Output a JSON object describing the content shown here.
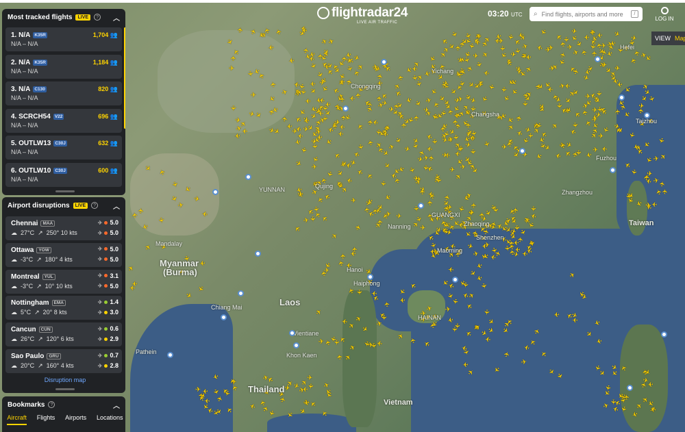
{
  "header": {
    "logo_text": "flightradar24",
    "logo_tagline": "LIVE AIR TRAFFIC",
    "time": "03:20",
    "time_zone": "UTC",
    "search_placeholder": "Find flights, airports and more",
    "search_shortcut": "/",
    "login_label": "LOG IN",
    "view_label": "VIEW",
    "view_value": "Map"
  },
  "tracked": {
    "title": "Most tracked flights",
    "live_badge": "LIVE",
    "flights": [
      {
        "rank_name": "1. N/A",
        "type": "K35R",
        "route": "N/A – N/A",
        "count": "1,704"
      },
      {
        "rank_name": "2. N/A",
        "type": "K35R",
        "route": "N/A – N/A",
        "count": "1,184"
      },
      {
        "rank_name": "3. N/A",
        "type": "C130",
        "route": "N/A – N/A",
        "count": "820"
      },
      {
        "rank_name": "4. SCRCH54",
        "type": "V22",
        "route": "N/A – N/A",
        "count": "696"
      },
      {
        "rank_name": "5. OUTLW13",
        "type": "C30J",
        "route": "N/A – N/A",
        "count": "632"
      },
      {
        "rank_name": "6. OUTLW10",
        "type": "C30J",
        "route": "N/A – N/A",
        "count": "600"
      }
    ]
  },
  "disruptions": {
    "title": "Airport disruptions",
    "live_badge": "LIVE",
    "airports": [
      {
        "city": "Chennai",
        "code": "MAA",
        "temp": "27°C",
        "wind": "250° 10 kts",
        "dep": "5.0",
        "arr": "5.0",
        "dep_color": "#ff6a2b",
        "arr_color": "#ff6a2b"
      },
      {
        "city": "Ottawa",
        "code": "YOW",
        "temp": "-3°C",
        "wind": "180° 4 kts",
        "dep": "5.0",
        "arr": "5.0",
        "dep_color": "#ff6a2b",
        "arr_color": "#ff6a2b"
      },
      {
        "city": "Montreal",
        "code": "YUL",
        "temp": "-3°C",
        "wind": "10° 10 kts",
        "dep": "3.1",
        "arr": "5.0",
        "dep_color": "#ff6a2b",
        "arr_color": "#ff6a2b"
      },
      {
        "city": "Nottingham",
        "code": "EMA",
        "temp": "5°C",
        "wind": "20° 8 kts",
        "dep": "1.4",
        "arr": "3.0",
        "dep_color": "#9acd32",
        "arr_color": "#ffd400"
      },
      {
        "city": "Cancun",
        "code": "CUN",
        "temp": "26°C",
        "wind": "120° 6 kts",
        "dep": "0.6",
        "arr": "2.9",
        "dep_color": "#9acd32",
        "arr_color": "#ffd400"
      },
      {
        "city": "Sao Paulo",
        "code": "GRU",
        "temp": "20°C",
        "wind": "160° 4 kts",
        "dep": "0.7",
        "arr": "2.8",
        "dep_color": "#9acd32",
        "arr_color": "#ffd400"
      }
    ],
    "link_label": "Disruption map"
  },
  "bookmarks": {
    "title": "Bookmarks",
    "tabs": [
      "Aircraft",
      "Flights",
      "Airports",
      "Locations"
    ]
  },
  "map_labels": [
    {
      "text": "Myanmar",
      "cls": "big"
    },
    {
      "text": "(Burma)",
      "cls": "big"
    },
    {
      "text": "Laos",
      "cls": "big"
    },
    {
      "text": "Thailand",
      "cls": "big"
    },
    {
      "text": "Taiwan",
      "cls": "mid"
    },
    {
      "text": "Vietnam",
      "cls": "mid"
    },
    {
      "text": "Mandalay",
      "cls": ""
    },
    {
      "text": "Chongqing",
      "cls": ""
    },
    {
      "text": "Changsha",
      "cls": ""
    },
    {
      "text": "Fuzhou",
      "cls": ""
    },
    {
      "text": "Taizhou",
      "cls": ""
    },
    {
      "text": "Zhaoqing",
      "cls": ""
    },
    {
      "text": "Maoming",
      "cls": ""
    },
    {
      "text": "Nanning",
      "cls": ""
    },
    {
      "text": "Hanoi",
      "cls": ""
    },
    {
      "text": "Haiphong",
      "cls": ""
    },
    {
      "text": "Vientiane",
      "cls": ""
    },
    {
      "text": "Khon Kaen",
      "cls": ""
    },
    {
      "text": "Chiang Mai",
      "cls": ""
    },
    {
      "text": "Pathein",
      "cls": ""
    },
    {
      "text": "Yichang",
      "cls": ""
    },
    {
      "text": "Hefei",
      "cls": ""
    },
    {
      "text": "Qujing",
      "cls": ""
    },
    {
      "text": "YUNNAN",
      "cls": ""
    },
    {
      "text": "GUANGXI",
      "cls": ""
    },
    {
      "text": "HAINAN",
      "cls": ""
    },
    {
      "text": "Shenzhen",
      "cls": ""
    },
    {
      "text": "Zhangzhou",
      "cls": ""
    }
  ]
}
